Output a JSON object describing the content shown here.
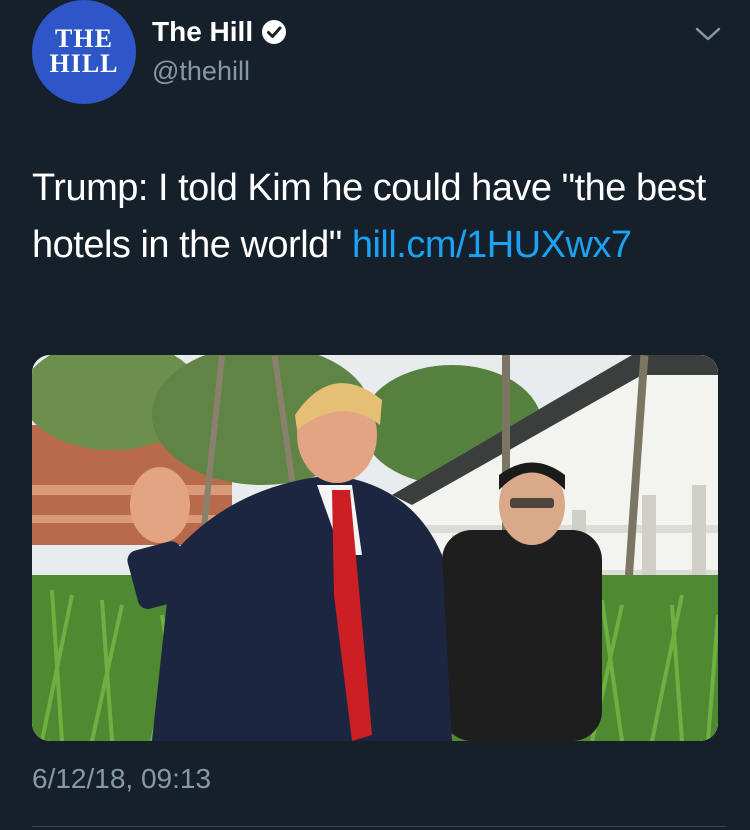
{
  "account": {
    "display_name": "The Hill",
    "handle": "@thehill",
    "avatar_line1": "THE",
    "avatar_line2": "HILL"
  },
  "tweet": {
    "text_before_link": "Trump: I told Kim he could have \"the best hotels in the world\" ",
    "link_text": "hill.cm/1HUXwx7",
    "timestamp": "6/12/18, 09:13"
  },
  "colors": {
    "background": "#15202b",
    "link": "#1da1f2",
    "secondary_text": "#8899a6",
    "avatar_bg": "#2e56c9"
  },
  "icons": {
    "verified": "verified-badge-icon",
    "menu": "chevron-down-icon"
  }
}
